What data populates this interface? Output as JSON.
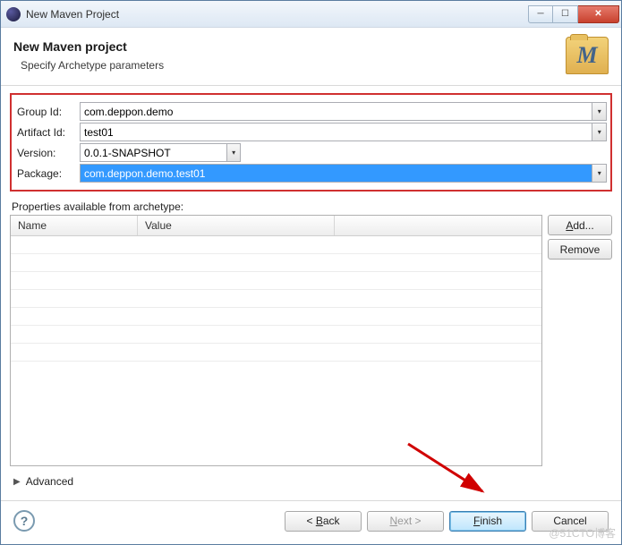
{
  "window": {
    "title": "New Maven Project"
  },
  "header": {
    "title": "New Maven project",
    "subtitle": "Specify Archetype parameters"
  },
  "form": {
    "groupId": {
      "label": "Group Id:",
      "value": "com.deppon.demo"
    },
    "artifactId": {
      "label": "Artifact Id:",
      "value": "test01"
    },
    "version": {
      "label": "Version:",
      "value": "0.0.1-SNAPSHOT"
    },
    "package": {
      "label": "Package:",
      "value": "com.deppon.demo.test01"
    }
  },
  "properties": {
    "label": "Properties available from archetype:",
    "columns": {
      "name": "Name",
      "value": "Value"
    },
    "rows": [],
    "addLabel": "Add...",
    "removeLabel": "Remove"
  },
  "advanced": {
    "label": "Advanced"
  },
  "buttons": {
    "back": "< Back",
    "next": "Next >",
    "finish": "Finish",
    "cancel": "Cancel"
  },
  "watermark": "@51CTO博客"
}
